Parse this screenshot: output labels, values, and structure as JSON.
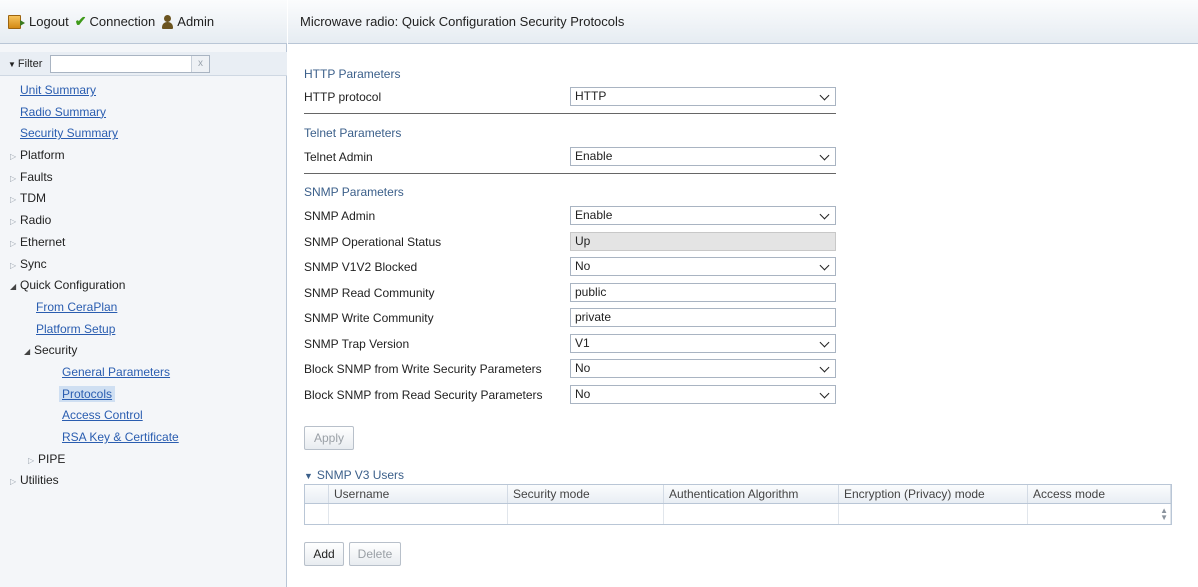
{
  "topbar": {
    "logout_label": "Logout",
    "connection_label": "Connection",
    "admin_label": "Admin"
  },
  "filter": {
    "label": "Filter",
    "value": "",
    "clear_glyph": "x"
  },
  "nav": {
    "unit_summary": "Unit Summary",
    "radio_summary": "Radio Summary",
    "security_summary": "Security Summary",
    "platform": "Platform",
    "faults": "Faults",
    "tdm": "TDM",
    "radio": "Radio",
    "ethernet": "Ethernet",
    "sync": "Sync",
    "quick_configuration": "Quick Configuration",
    "from_ceraplan": "From CeraPlan",
    "platform_setup": "Platform Setup",
    "security": "Security",
    "general_parameters": "General Parameters",
    "protocols": "Protocols",
    "access_control": "Access Control",
    "rsa_key": "RSA Key & Certificate",
    "pipe": "PIPE",
    "utilities": "Utilities"
  },
  "main": {
    "title": "Microwave radio: Quick Configuration Security Protocols",
    "http": {
      "heading": "HTTP Parameters",
      "protocol_label": "HTTP protocol",
      "protocol_value": "HTTP"
    },
    "telnet": {
      "heading": "Telnet Parameters",
      "admin_label": "Telnet Admin",
      "admin_value": "Enable"
    },
    "snmp": {
      "heading": "SNMP Parameters",
      "admin_label": "SNMP Admin",
      "admin_value": "Enable",
      "op_status_label": "SNMP Operational Status",
      "op_status_value": "Up",
      "v1v2_label": "SNMP V1V2 Blocked",
      "v1v2_value": "No",
      "read_comm_label": "SNMP Read Community",
      "read_comm_value": "public",
      "write_comm_label": "SNMP Write Community",
      "write_comm_value": "private",
      "trap_label": "SNMP Trap Version",
      "trap_value": "V1",
      "block_write_label": "Block SNMP from Write Security Parameters",
      "block_write_value": "No",
      "block_read_label": "Block SNMP from Read Security Parameters",
      "block_read_value": "No"
    },
    "apply_label": "Apply",
    "v3": {
      "heading": "SNMP V3 Users",
      "columns": [
        "Username",
        "Security mode",
        "Authentication Algorithm",
        "Encryption (Privacy) mode",
        "Access mode"
      ]
    },
    "add_label": "Add",
    "delete_label": "Delete"
  }
}
